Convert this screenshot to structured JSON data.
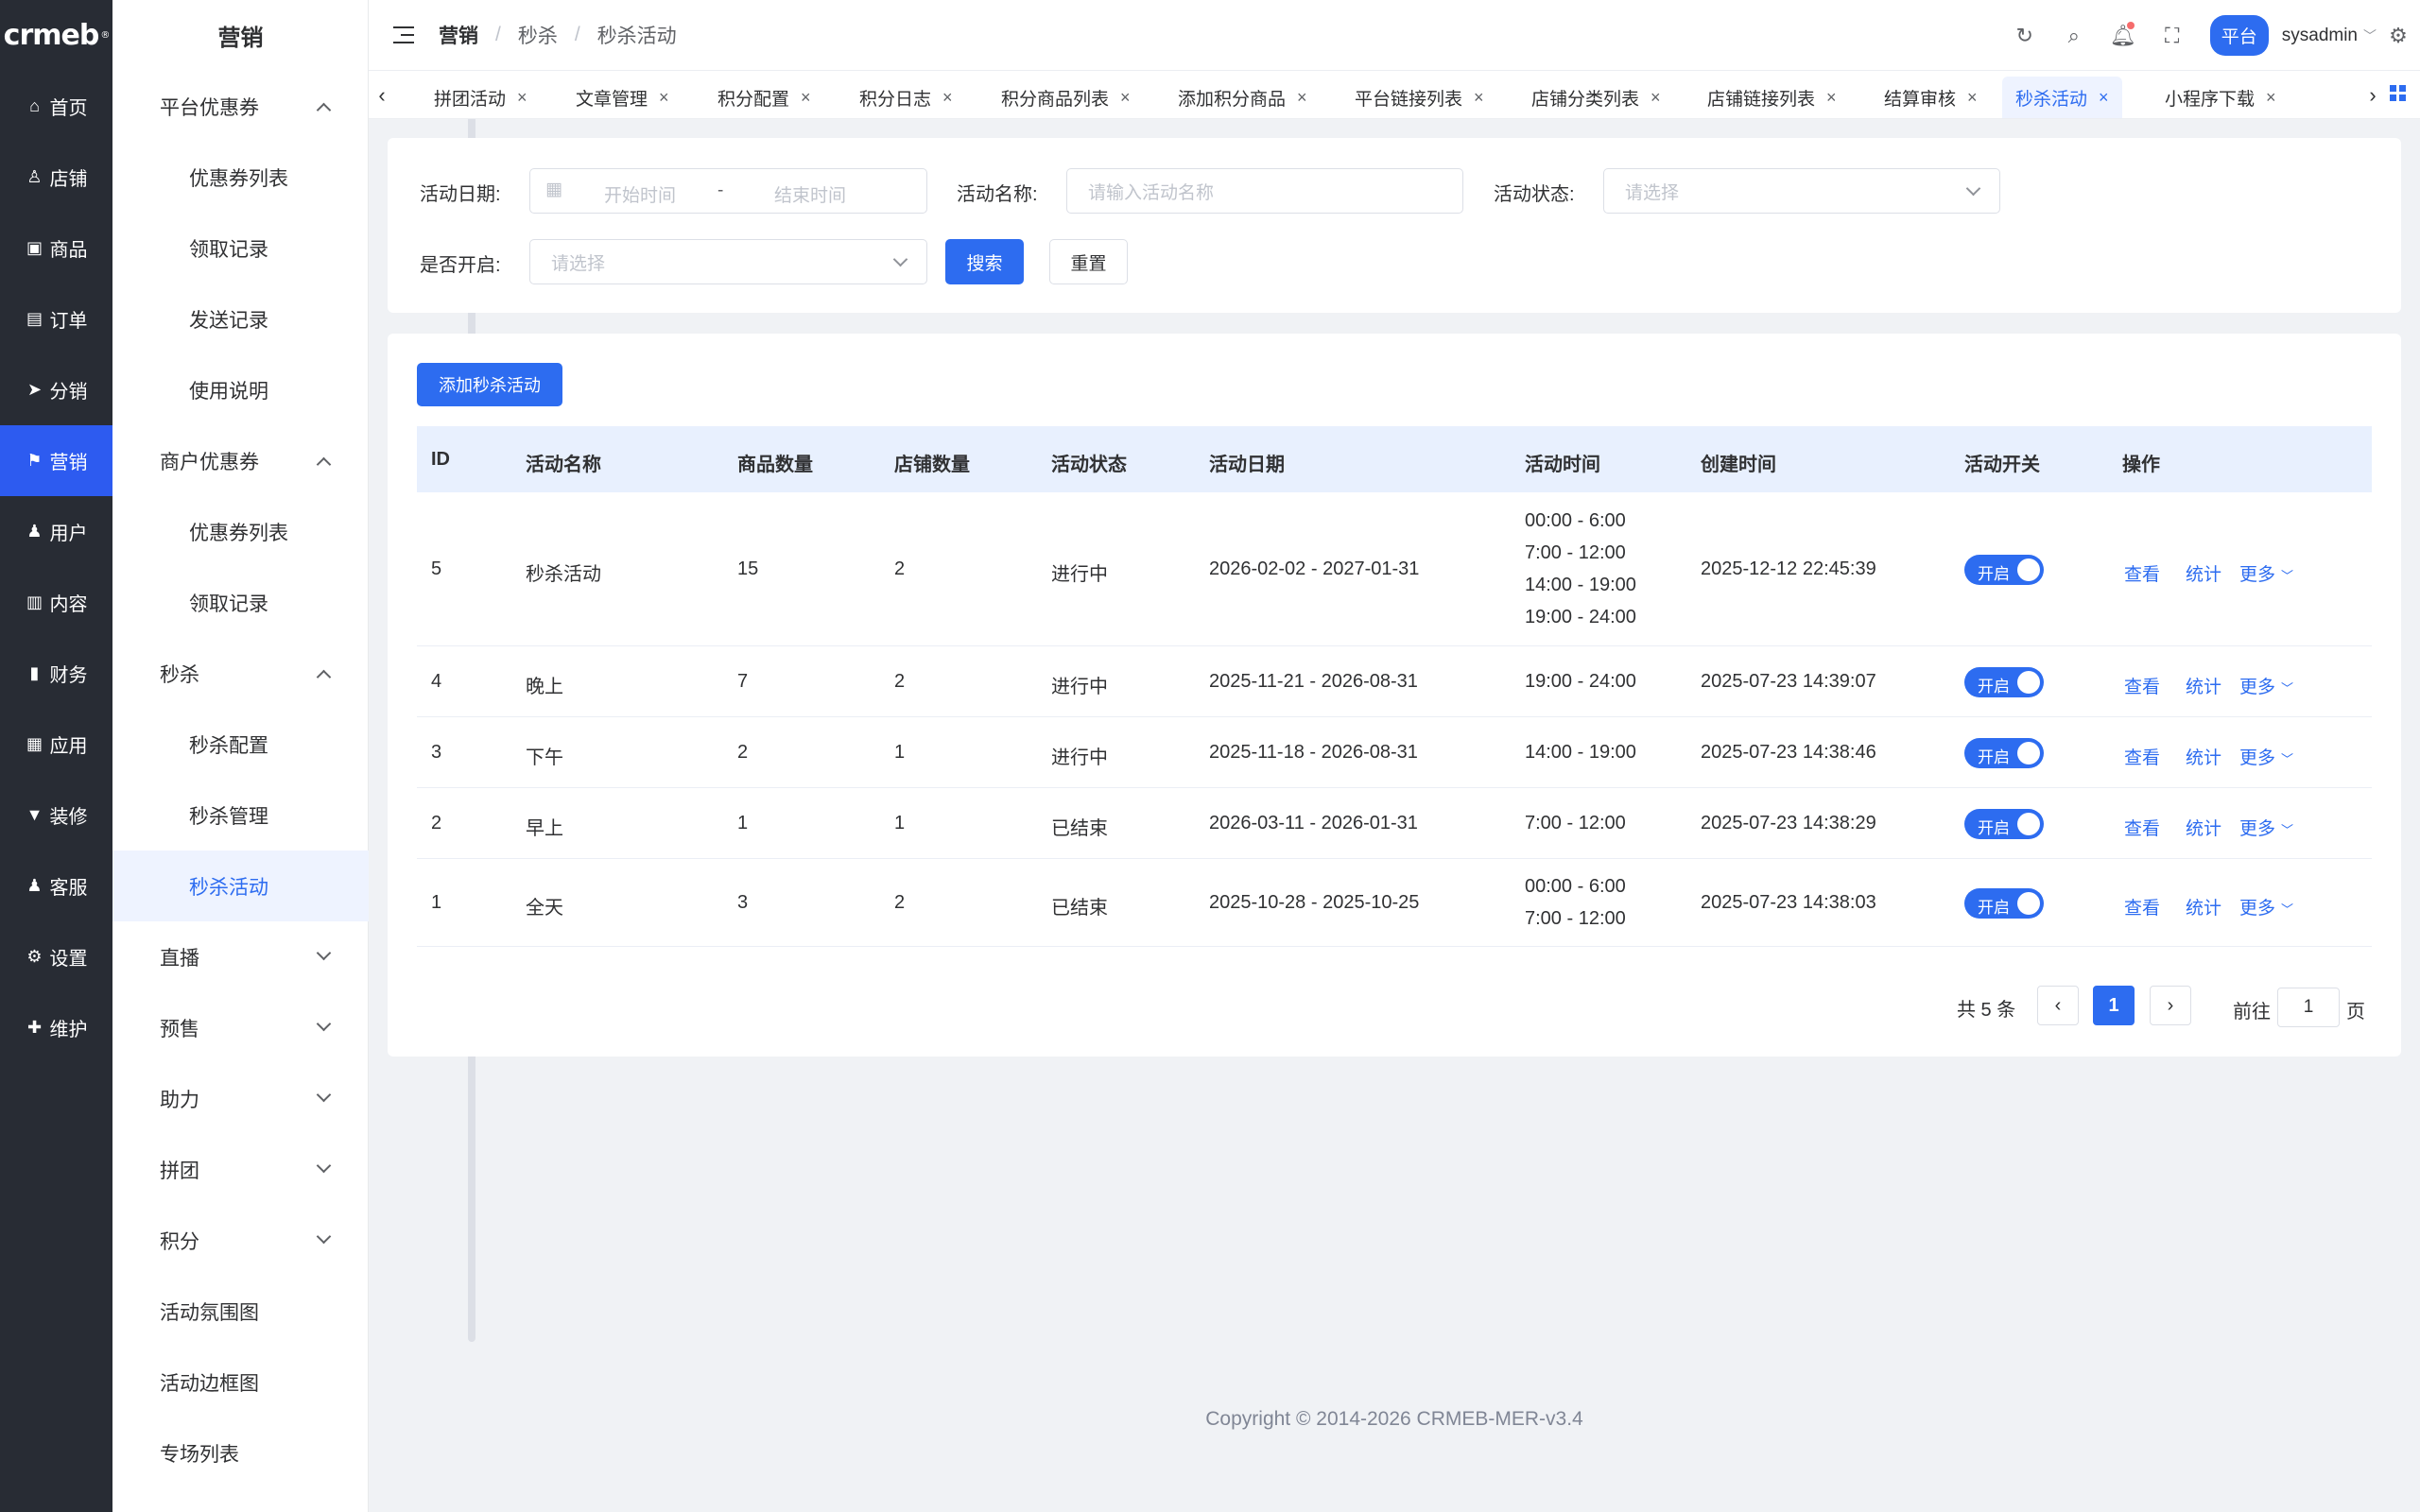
{
  "rail": {
    "logo": "crmeb",
    "logo_mark": "®",
    "items": [
      {
        "label": "首页",
        "icon": "home-icon",
        "glyph": "⌂"
      },
      {
        "label": "店铺",
        "icon": "shop-icon",
        "glyph": "♙"
      },
      {
        "label": "商品",
        "icon": "bag-icon",
        "glyph": "▣"
      },
      {
        "label": "订单",
        "icon": "order-icon",
        "glyph": "▤"
      },
      {
        "label": "分销",
        "icon": "distribution-icon",
        "glyph": "➤"
      },
      {
        "label": "营销",
        "icon": "flag-icon",
        "glyph": "⚑"
      },
      {
        "label": "用户",
        "icon": "user-icon",
        "glyph": "♟"
      },
      {
        "label": "内容",
        "icon": "content-icon",
        "glyph": "▥"
      },
      {
        "label": "财务",
        "icon": "finance-icon",
        "glyph": "▮"
      },
      {
        "label": "应用",
        "icon": "apps-icon",
        "glyph": "▦"
      },
      {
        "label": "装修",
        "icon": "decorate-icon",
        "glyph": "▼"
      },
      {
        "label": "客服",
        "icon": "service-icon",
        "glyph": "♟"
      },
      {
        "label": "设置",
        "icon": "gear-icon",
        "glyph": "⚙"
      },
      {
        "label": "维护",
        "icon": "maintain-icon",
        "glyph": "✚"
      }
    ]
  },
  "submenu": {
    "title": "营销",
    "items": [
      {
        "label": "平台优惠券",
        "type": "group",
        "arrow": "up"
      },
      {
        "label": "优惠券列表",
        "type": "child"
      },
      {
        "label": "领取记录",
        "type": "child"
      },
      {
        "label": "发送记录",
        "type": "child"
      },
      {
        "label": "使用说明",
        "type": "child"
      },
      {
        "label": "商户优惠券",
        "type": "group",
        "arrow": "up"
      },
      {
        "label": "优惠券列表",
        "type": "child"
      },
      {
        "label": "领取记录",
        "type": "child"
      },
      {
        "label": "秒杀",
        "type": "group",
        "arrow": "up"
      },
      {
        "label": "秒杀配置",
        "type": "child"
      },
      {
        "label": "秒杀管理",
        "type": "child"
      },
      {
        "label": "秒杀活动",
        "type": "child",
        "active": true
      },
      {
        "label": "直播",
        "type": "group",
        "arrow": "down"
      },
      {
        "label": "预售",
        "type": "group",
        "arrow": "down"
      },
      {
        "label": "助力",
        "type": "group",
        "arrow": "down"
      },
      {
        "label": "拼团",
        "type": "group",
        "arrow": "down"
      },
      {
        "label": "积分",
        "type": "group",
        "arrow": "down"
      },
      {
        "label": "活动氛围图",
        "type": "group"
      },
      {
        "label": "活动边框图",
        "type": "group"
      },
      {
        "label": "专场列表",
        "type": "group"
      }
    ]
  },
  "header": {
    "breadcrumb": [
      "营销",
      "秒杀",
      "秒杀活动"
    ],
    "separator": "/",
    "platform_button": "平台",
    "username": "sysadmin"
  },
  "tabs": [
    {
      "label": "拼团活动"
    },
    {
      "label": "文章管理"
    },
    {
      "label": "积分配置"
    },
    {
      "label": "积分日志"
    },
    {
      "label": "积分商品列表"
    },
    {
      "label": "添加积分商品"
    },
    {
      "label": "平台链接列表"
    },
    {
      "label": "店铺分类列表"
    },
    {
      "label": "店铺链接列表"
    },
    {
      "label": "结算审核"
    },
    {
      "label": "秒杀活动",
      "active": true
    },
    {
      "label": "小程序下载"
    }
  ],
  "filters": {
    "date_label": "活动日期:",
    "date_start_placeholder": "开始时间",
    "date_separator": "-",
    "date_end_placeholder": "结束时间",
    "name_label": "活动名称:",
    "name_placeholder": "请输入活动名称",
    "status_label": "活动状态:",
    "status_placeholder": "请选择",
    "open_label": "是否开启:",
    "open_placeholder": "请选择",
    "search_button": "搜索",
    "reset_button": "重置"
  },
  "add_button": "添加秒杀活动",
  "table": {
    "columns": [
      "ID",
      "活动名称",
      "商品数量",
      "店铺数量",
      "活动状态",
      "活动日期",
      "活动时间",
      "创建时间",
      "活动开关",
      "操作"
    ],
    "rows": [
      {
        "id": "5",
        "name": "秒杀活动",
        "goods": "15",
        "shops": "2",
        "status": "进行中",
        "date": "2026-02-02 - 2027-01-31",
        "times": [
          "00:00 - 6:00",
          "7:00 - 12:00",
          "14:00 - 19:00",
          "19:00 - 24:00"
        ],
        "created": "2025-12-12 22:45:39",
        "switch": "开启"
      },
      {
        "id": "4",
        "name": "晚上",
        "goods": "7",
        "shops": "2",
        "status": "进行中",
        "date": "2025-11-21 - 2026-08-31",
        "times": [
          "19:00 - 24:00"
        ],
        "created": "2025-07-23 14:39:07",
        "switch": "开启"
      },
      {
        "id": "3",
        "name": "下午",
        "goods": "2",
        "shops": "1",
        "status": "进行中",
        "date": "2025-11-18 - 2026-08-31",
        "times": [
          "14:00 - 19:00"
        ],
        "created": "2025-07-23 14:38:46",
        "switch": "开启"
      },
      {
        "id": "2",
        "name": "早上",
        "goods": "1",
        "shops": "1",
        "status": "已结束",
        "date": "2026-03-11 - 2026-01-31",
        "times": [
          "7:00 - 12:00"
        ],
        "created": "2025-07-23 14:38:29",
        "switch": "开启"
      },
      {
        "id": "1",
        "name": "全天",
        "goods": "3",
        "shops": "2",
        "status": "已结束",
        "date": "2025-10-28 - 2025-10-25",
        "times": [
          "00:00 - 6:00",
          "7:00 - 12:00"
        ],
        "created": "2025-07-23 14:38:03",
        "switch": "开启"
      }
    ],
    "actions": {
      "view": "查看",
      "stats": "统计",
      "more": "更多"
    }
  },
  "pagination": {
    "total": "共 5 条",
    "current": "1",
    "goto_label": "前往",
    "goto_value": "1",
    "page_suffix": "页"
  },
  "footer": "Copyright © 2014-2026 CRMEB-MER-v3.4",
  "colors": {
    "accent": "#2d6cf0",
    "rail_bg": "#282c34",
    "rail_active": "#2d5bf0"
  }
}
